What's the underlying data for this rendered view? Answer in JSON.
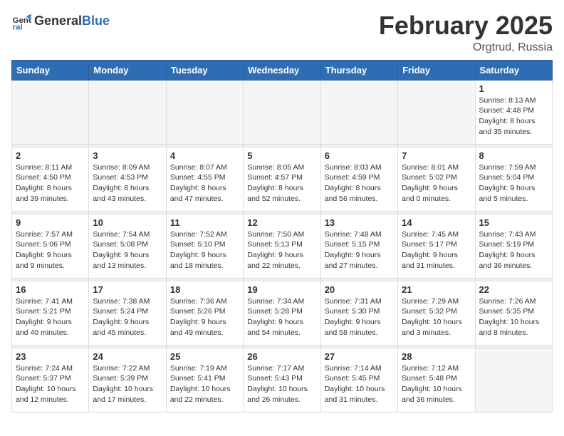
{
  "header": {
    "logo_general": "General",
    "logo_blue": "Blue",
    "month_year": "February 2025",
    "location": "Orgtrud, Russia"
  },
  "weekdays": [
    "Sunday",
    "Monday",
    "Tuesday",
    "Wednesday",
    "Thursday",
    "Friday",
    "Saturday"
  ],
  "weeks": [
    [
      {
        "day": "",
        "info": ""
      },
      {
        "day": "",
        "info": ""
      },
      {
        "day": "",
        "info": ""
      },
      {
        "day": "",
        "info": ""
      },
      {
        "day": "",
        "info": ""
      },
      {
        "day": "",
        "info": ""
      },
      {
        "day": "1",
        "info": "Sunrise: 8:13 AM\nSunset: 4:48 PM\nDaylight: 8 hours and 35 minutes."
      }
    ],
    [
      {
        "day": "2",
        "info": "Sunrise: 8:11 AM\nSunset: 4:50 PM\nDaylight: 8 hours and 39 minutes."
      },
      {
        "day": "3",
        "info": "Sunrise: 8:09 AM\nSunset: 4:53 PM\nDaylight: 8 hours and 43 minutes."
      },
      {
        "day": "4",
        "info": "Sunrise: 8:07 AM\nSunset: 4:55 PM\nDaylight: 8 hours and 47 minutes."
      },
      {
        "day": "5",
        "info": "Sunrise: 8:05 AM\nSunset: 4:57 PM\nDaylight: 8 hours and 52 minutes."
      },
      {
        "day": "6",
        "info": "Sunrise: 8:03 AM\nSunset: 4:59 PM\nDaylight: 8 hours and 56 minutes."
      },
      {
        "day": "7",
        "info": "Sunrise: 8:01 AM\nSunset: 5:02 PM\nDaylight: 9 hours and 0 minutes."
      },
      {
        "day": "8",
        "info": "Sunrise: 7:59 AM\nSunset: 5:04 PM\nDaylight: 9 hours and 5 minutes."
      }
    ],
    [
      {
        "day": "9",
        "info": "Sunrise: 7:57 AM\nSunset: 5:06 PM\nDaylight: 9 hours and 9 minutes."
      },
      {
        "day": "10",
        "info": "Sunrise: 7:54 AM\nSunset: 5:08 PM\nDaylight: 9 hours and 13 minutes."
      },
      {
        "day": "11",
        "info": "Sunrise: 7:52 AM\nSunset: 5:10 PM\nDaylight: 9 hours and 18 minutes."
      },
      {
        "day": "12",
        "info": "Sunrise: 7:50 AM\nSunset: 5:13 PM\nDaylight: 9 hours and 22 minutes."
      },
      {
        "day": "13",
        "info": "Sunrise: 7:48 AM\nSunset: 5:15 PM\nDaylight: 9 hours and 27 minutes."
      },
      {
        "day": "14",
        "info": "Sunrise: 7:45 AM\nSunset: 5:17 PM\nDaylight: 9 hours and 31 minutes."
      },
      {
        "day": "15",
        "info": "Sunrise: 7:43 AM\nSunset: 5:19 PM\nDaylight: 9 hours and 36 minutes."
      }
    ],
    [
      {
        "day": "16",
        "info": "Sunrise: 7:41 AM\nSunset: 5:21 PM\nDaylight: 9 hours and 40 minutes."
      },
      {
        "day": "17",
        "info": "Sunrise: 7:38 AM\nSunset: 5:24 PM\nDaylight: 9 hours and 45 minutes."
      },
      {
        "day": "18",
        "info": "Sunrise: 7:36 AM\nSunset: 5:26 PM\nDaylight: 9 hours and 49 minutes."
      },
      {
        "day": "19",
        "info": "Sunrise: 7:34 AM\nSunset: 5:28 PM\nDaylight: 9 hours and 54 minutes."
      },
      {
        "day": "20",
        "info": "Sunrise: 7:31 AM\nSunset: 5:30 PM\nDaylight: 9 hours and 58 minutes."
      },
      {
        "day": "21",
        "info": "Sunrise: 7:29 AM\nSunset: 5:32 PM\nDaylight: 10 hours and 3 minutes."
      },
      {
        "day": "22",
        "info": "Sunrise: 7:26 AM\nSunset: 5:35 PM\nDaylight: 10 hours and 8 minutes."
      }
    ],
    [
      {
        "day": "23",
        "info": "Sunrise: 7:24 AM\nSunset: 5:37 PM\nDaylight: 10 hours and 12 minutes."
      },
      {
        "day": "24",
        "info": "Sunrise: 7:22 AM\nSunset: 5:39 PM\nDaylight: 10 hours and 17 minutes."
      },
      {
        "day": "25",
        "info": "Sunrise: 7:19 AM\nSunset: 5:41 PM\nDaylight: 10 hours and 22 minutes."
      },
      {
        "day": "26",
        "info": "Sunrise: 7:17 AM\nSunset: 5:43 PM\nDaylight: 10 hours and 26 minutes."
      },
      {
        "day": "27",
        "info": "Sunrise: 7:14 AM\nSunset: 5:45 PM\nDaylight: 10 hours and 31 minutes."
      },
      {
        "day": "28",
        "info": "Sunrise: 7:12 AM\nSunset: 5:48 PM\nDaylight: 10 hours and 36 minutes."
      },
      {
        "day": "",
        "info": ""
      }
    ]
  ]
}
